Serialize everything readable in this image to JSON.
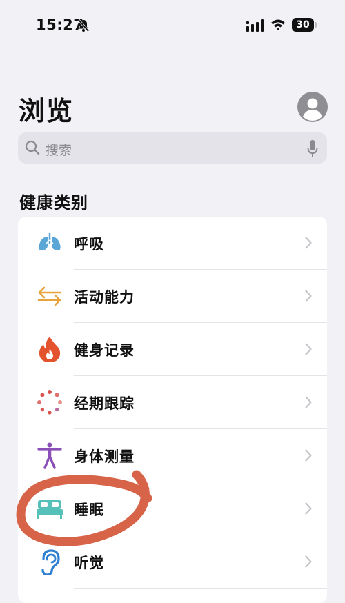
{
  "status_bar": {
    "time": "15:27",
    "battery": "30"
  },
  "page_title": "浏览",
  "search": {
    "placeholder": "搜索"
  },
  "section_title": "健康类别",
  "categories": [
    {
      "label": "呼吸",
      "icon": "lungs-icon",
      "color": "#5aa6d6"
    },
    {
      "label": "活动能力",
      "icon": "arrows-icon",
      "color": "#e8a33c"
    },
    {
      "label": "健身记录",
      "icon": "flame-icon",
      "color": "#e3532d"
    },
    {
      "label": "经期跟踪",
      "icon": "cycle-dots-icon",
      "color": "#d9534f"
    },
    {
      "label": "身体测量",
      "icon": "figure-icon",
      "color": "#8b4fb8"
    },
    {
      "label": "睡眠",
      "icon": "bed-icon",
      "color": "#55c1b8"
    },
    {
      "label": "听觉",
      "icon": "ear-icon",
      "color": "#2f7fd1"
    }
  ],
  "annotation_color": "#d4583a"
}
